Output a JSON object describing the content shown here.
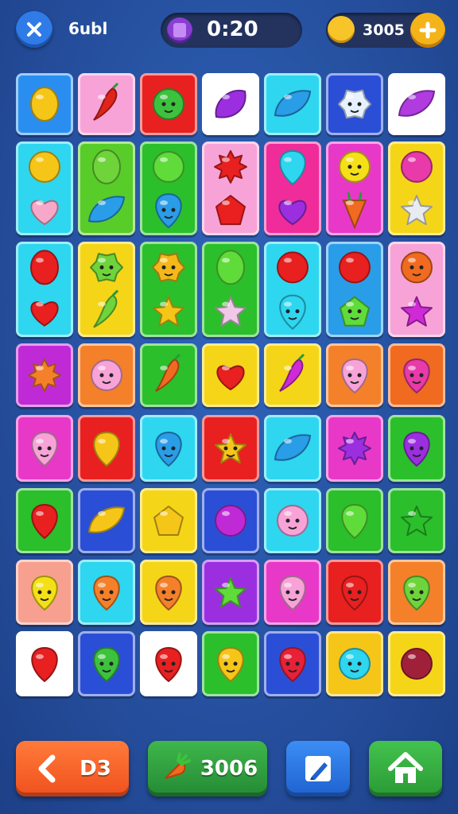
{
  "header": {
    "close_icon": "close-icon",
    "level_label": "6ubl",
    "timer_icon": "potion-icon",
    "timer": "0:20",
    "coin_icon": "coin-icon",
    "coins": "3005",
    "add_icon": "plus-icon"
  },
  "board": {
    "rows": [
      [
        {
          "color": "#2a8ef0",
          "items": [
            {
              "shape": "lemon",
              "color": "#f5c518"
            }
          ]
        },
        {
          "color": "#f7a3d8",
          "items": [
            {
              "shape": "pepper",
              "color": "#e0241b"
            }
          ]
        },
        {
          "color": "#e82020",
          "items": [
            {
              "shape": "round",
              "color": "#3dc23d",
              "face": true
            }
          ]
        },
        {
          "color": "#ffffff",
          "items": [
            {
              "shape": "blob",
              "color": "#9b2fe0"
            }
          ]
        },
        {
          "color": "#2ed6f0",
          "items": [
            {
              "shape": "leaf",
              "color": "#2a9de8"
            }
          ]
        },
        {
          "color": "#2a4fd6",
          "items": [
            {
              "shape": "monster",
              "color": "#e6f2ff",
              "face": true
            }
          ]
        },
        {
          "color": "#ffffff",
          "items": [
            {
              "shape": "leaf",
              "color": "#b03ce0"
            }
          ]
        }
      ],
      [
        {
          "color": "#2ed6f0",
          "items": [
            {
              "shape": "round",
              "color": "#f5c518"
            },
            {
              "shape": "heart",
              "color": "#f7a8c8"
            }
          ]
        },
        {
          "color": "#58cc28",
          "items": [
            {
              "shape": "lemon",
              "color": "#6ed43a"
            },
            {
              "shape": "leaf",
              "color": "#2a9de8"
            }
          ]
        },
        {
          "color": "#2bbf2b",
          "items": [
            {
              "shape": "round",
              "color": "#5fdc3a"
            },
            {
              "shape": "drop",
              "color": "#2a9de8",
              "face": true
            }
          ]
        },
        {
          "color": "#f7a3d8",
          "items": [
            {
              "shape": "splat",
              "color": "#e82020"
            },
            {
              "shape": "pentagon",
              "color": "#e82020"
            }
          ]
        },
        {
          "color": "#f02b9a",
          "items": [
            {
              "shape": "drop",
              "color": "#2ed6f0"
            },
            {
              "shape": "heart",
              "color": "#9b2fe0"
            }
          ]
        },
        {
          "color": "#e838c8",
          "items": [
            {
              "shape": "round",
              "color": "#f5e018",
              "face": true
            },
            {
              "shape": "carrot",
              "color": "#f06a20"
            }
          ]
        },
        {
          "color": "#f5d518",
          "items": [
            {
              "shape": "round",
              "color": "#e83aa8"
            },
            {
              "shape": "star",
              "color": "#e8ecf2"
            }
          ]
        }
      ],
      [
        {
          "color": "#2ed6f0",
          "items": [
            {
              "shape": "lemon",
              "color": "#e82020"
            },
            {
              "shape": "heart",
              "color": "#e82020"
            }
          ]
        },
        {
          "color": "#f5d518",
          "items": [
            {
              "shape": "monster",
              "color": "#6ed43a",
              "face": true
            },
            {
              "shape": "pepper",
              "color": "#6ed43a"
            }
          ]
        },
        {
          "color": "#2bbf2b",
          "items": [
            {
              "shape": "monster",
              "color": "#f5b818",
              "face": true
            },
            {
              "shape": "star",
              "color": "#f5c518"
            }
          ]
        },
        {
          "color": "#2bbf2b",
          "items": [
            {
              "shape": "lemon",
              "color": "#5fdc3a"
            },
            {
              "shape": "star",
              "color": "#f0c8e8"
            }
          ]
        },
        {
          "color": "#2ed6f0",
          "items": [
            {
              "shape": "round",
              "color": "#e82020"
            },
            {
              "shape": "drop",
              "color": "#2ed6f0",
              "face": true
            }
          ]
        },
        {
          "color": "#2a9de8",
          "items": [
            {
              "shape": "round",
              "color": "#e82020"
            },
            {
              "shape": "pentagon",
              "color": "#5fdc3a",
              "face": true
            }
          ]
        },
        {
          "color": "#f7a3d8",
          "items": [
            {
              "shape": "round",
              "color": "#f06a20",
              "face": true
            },
            {
              "shape": "star",
              "color": "#d02ad6"
            }
          ]
        }
      ],
      [
        {
          "color": "#c02ad6",
          "items": [
            {
              "shape": "splat",
              "color": "#f5802a"
            }
          ]
        },
        {
          "color": "#f5802a",
          "items": [
            {
              "shape": "round",
              "color": "#f7a3d8",
              "face": true
            }
          ]
        },
        {
          "color": "#2bbf2b",
          "items": [
            {
              "shape": "pepper",
              "color": "#f06a20"
            }
          ]
        },
        {
          "color": "#f5d518",
          "items": [
            {
              "shape": "heart",
              "color": "#e82020"
            }
          ]
        },
        {
          "color": "#f5d518",
          "items": [
            {
              "shape": "pepper",
              "color": "#d02ad6"
            }
          ]
        },
        {
          "color": "#f5802a",
          "items": [
            {
              "shape": "drop",
              "color": "#f7a3d8",
              "face": true
            }
          ]
        },
        {
          "color": "#f06a20",
          "items": [
            {
              "shape": "drop",
              "color": "#e83aa8",
              "face": true
            }
          ]
        }
      ],
      [
        {
          "color": "#e838c8",
          "items": [
            {
              "shape": "drop",
              "color": "#f7a3d8",
              "face": true
            }
          ]
        },
        {
          "color": "#e82020",
          "items": [
            {
              "shape": "drop",
              "color": "#f5c518"
            }
          ]
        },
        {
          "color": "#2ed6f0",
          "items": [
            {
              "shape": "drop",
              "color": "#2a9de8",
              "face": true
            }
          ]
        },
        {
          "color": "#e82020",
          "items": [
            {
              "shape": "star",
              "color": "#f5c518",
              "face": true
            }
          ]
        },
        {
          "color": "#2ed6f0",
          "items": [
            {
              "shape": "leaf",
              "color": "#2a9de8"
            }
          ]
        },
        {
          "color": "#e838c8",
          "items": [
            {
              "shape": "splat",
              "color": "#9b2fe0"
            }
          ]
        },
        {
          "color": "#2bbf2b",
          "items": [
            {
              "shape": "drop",
              "color": "#9b2fe0",
              "face": true
            }
          ]
        }
      ],
      [
        {
          "color": "#2bbf2b",
          "items": [
            {
              "shape": "drop",
              "color": "#e82020"
            }
          ]
        },
        {
          "color": "#2a4fd6",
          "items": [
            {
              "shape": "leaf",
              "color": "#f5c518"
            }
          ]
        },
        {
          "color": "#f5d518",
          "items": [
            {
              "shape": "pentagon",
              "color": "#f5c518"
            }
          ]
        },
        {
          "color": "#2a4fd6",
          "items": [
            {
              "shape": "round",
              "color": "#c02ad6"
            }
          ]
        },
        {
          "color": "#2ed6f0",
          "items": [
            {
              "shape": "round",
              "color": "#f7a3d8",
              "face": true
            }
          ]
        },
        {
          "color": "#2bbf2b",
          "items": [
            {
              "shape": "drop",
              "color": "#5fdc3a"
            }
          ]
        },
        {
          "color": "#2bbf2b",
          "items": [
            {
              "shape": "star",
              "color": "#2bbf2b"
            }
          ]
        }
      ],
      [
        {
          "color": "#f7a090",
          "items": [
            {
              "shape": "drop",
              "color": "#f5e018",
              "face": true
            }
          ]
        },
        {
          "color": "#2ed6f0",
          "items": [
            {
              "shape": "drop",
              "color": "#f5802a",
              "face": true
            }
          ]
        },
        {
          "color": "#f5d518",
          "items": [
            {
              "shape": "drop",
              "color": "#f5802a",
              "face": true
            }
          ]
        },
        {
          "color": "#9b2fe0",
          "items": [
            {
              "shape": "star",
              "color": "#5fdc3a"
            }
          ]
        },
        {
          "color": "#e838c8",
          "items": [
            {
              "shape": "drop",
              "color": "#f7a3d8",
              "face": true
            }
          ]
        },
        {
          "color": "#e82020",
          "items": [
            {
              "shape": "drop",
              "color": "#e82020",
              "face": true
            }
          ]
        },
        {
          "color": "#f5802a",
          "items": [
            {
              "shape": "drop",
              "color": "#6ed43a",
              "face": true
            }
          ]
        }
      ],
      [
        {
          "color": "#ffffff",
          "items": [
            {
              "shape": "drop",
              "color": "#e82020"
            }
          ]
        },
        {
          "color": "#2a4fd6",
          "items": [
            {
              "shape": "drop",
              "color": "#3dc23d",
              "face": true
            }
          ]
        },
        {
          "color": "#ffffff",
          "items": [
            {
              "shape": "drop",
              "color": "#e82020",
              "face": true
            }
          ]
        },
        {
          "color": "#2bbf2b",
          "items": [
            {
              "shape": "drop",
              "color": "#f5c518",
              "face": true
            }
          ]
        },
        {
          "color": "#2a4fd6",
          "items": [
            {
              "shape": "drop",
              "color": "#e82038",
              "face": true
            }
          ]
        },
        {
          "color": "#f5c518",
          "items": [
            {
              "shape": "round",
              "color": "#2ed6f0",
              "face": true
            }
          ]
        },
        {
          "color": "#f5d518",
          "items": [
            {
              "shape": "round",
              "color": "#a0203a"
            }
          ]
        }
      ]
    ]
  },
  "footer": {
    "back_icon": "chevron-left-icon",
    "back_label": "D3",
    "fruit_icon": "carrot-icon",
    "fruit_count": "3006",
    "edit_icon": "edit-icon",
    "home_icon": "home-icon"
  }
}
